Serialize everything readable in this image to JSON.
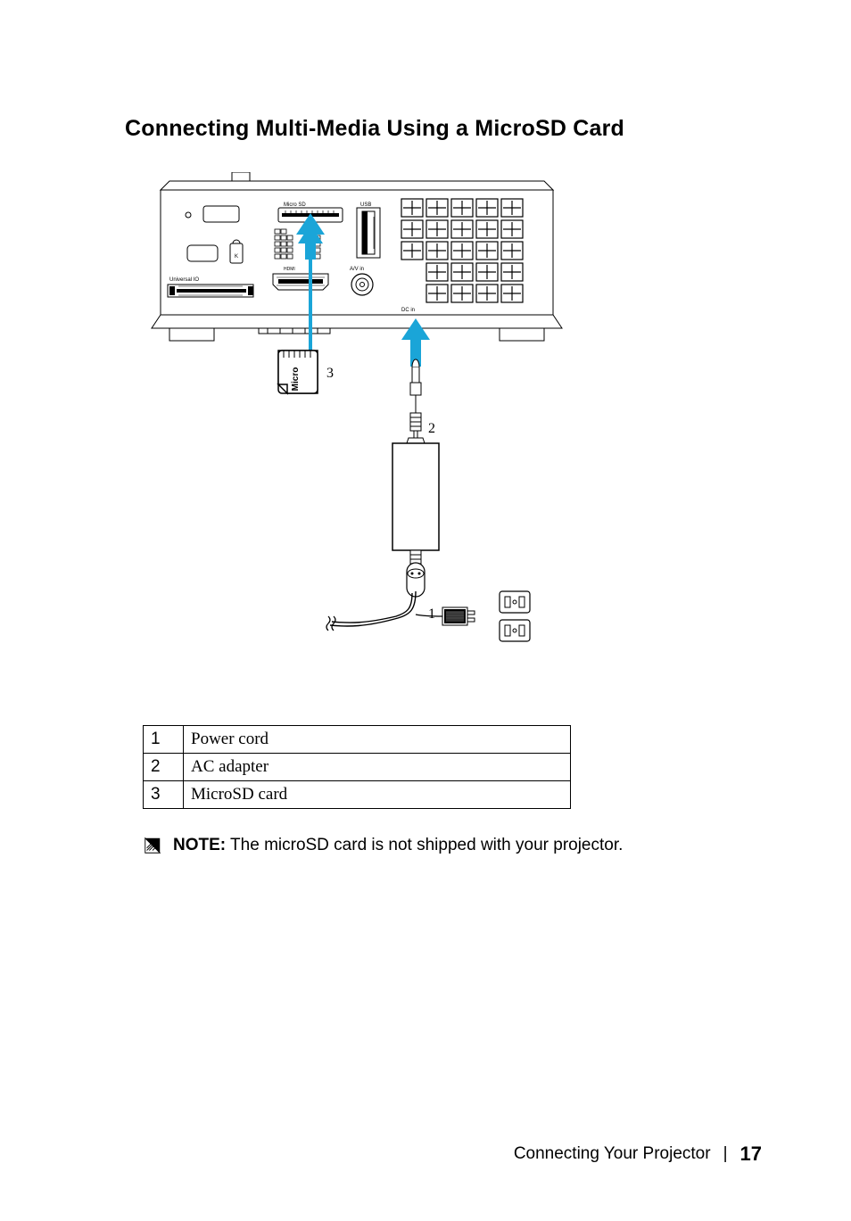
{
  "heading": "Connecting Multi-Media Using a MicroSD Card",
  "figure": {
    "labels": {
      "microsd": "Micro SD",
      "usb": "USB",
      "universal_io": "Universal IO",
      "avin": "A/V in",
      "dcin": "DC in",
      "hdmi": "HDMI",
      "lock": "K",
      "sdcard_text": "Micro"
    },
    "callouts": {
      "one": "1",
      "two": "2",
      "three": "3"
    }
  },
  "table": {
    "rows": [
      {
        "idx": "1",
        "desc": "Power cord"
      },
      {
        "idx": "2",
        "desc": "AC adapter"
      },
      {
        "idx": "3",
        "desc": "MicroSD card"
      }
    ]
  },
  "note": {
    "label": "NOTE:",
    "body": " The microSD card is not shipped with your projector."
  },
  "footer": {
    "section": "Connecting Your Projector",
    "page": "17"
  }
}
